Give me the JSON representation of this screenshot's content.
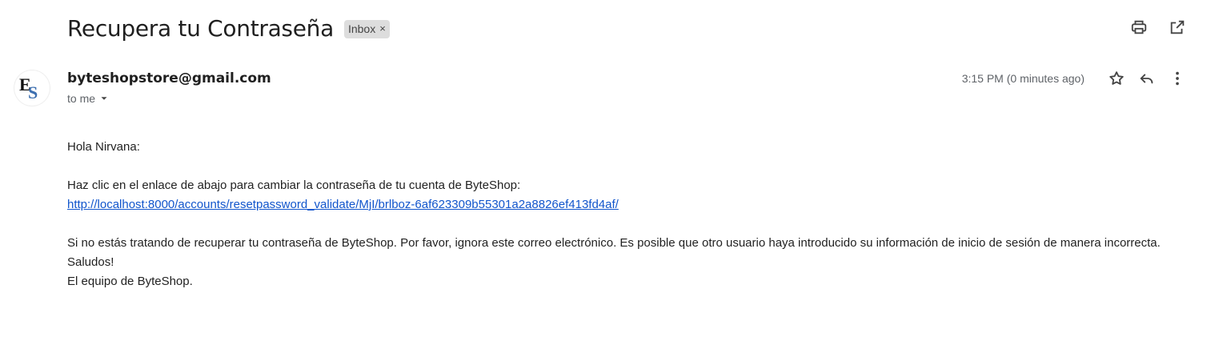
{
  "email": {
    "subject": "Recupera tu Contraseña",
    "label": "Inbox",
    "label_close": "×",
    "sender": "byteshopstore@gmail.com",
    "recipient_text": "to me",
    "timestamp": "3:15 PM (0 minutes ago)",
    "body": {
      "greeting": "Hola Nirvana:",
      "instruction": "Haz clic en el enlace de abajo para cambiar la contraseña de tu cuenta de ByteShop:",
      "link": "http://localhost:8000/accounts/resetpassword_validate/MjI/brlboz-6af623309b55301a2a8826ef413fd4af/",
      "notice": "Si no estás tratando de recuperar tu contraseña de ByteShop. Por favor, ignora este correo electrónico. Es posible que otro usuario haya introducido su información de inicio de sesión de manera incorrecta.",
      "closing": "Saludos!",
      "signature": "El equipo de ByteShop."
    }
  },
  "icons": {
    "print": "print-icon",
    "open_new_window": "open-in-new-window-icon",
    "star": "star-icon",
    "reply": "reply-icon",
    "more": "more-vertical-icon",
    "dropdown": "chevron-down-icon"
  }
}
